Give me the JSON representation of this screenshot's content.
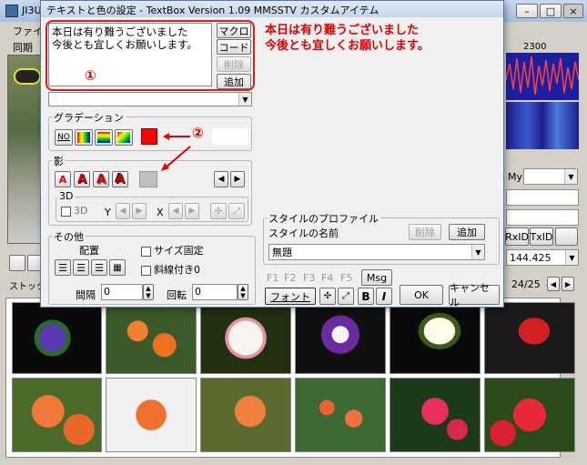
{
  "background_window": {
    "title": "JI3U",
    "menu_file": "ファイル",
    "sync_label": "同期",
    "freq_label": "2300",
    "my_label": "My",
    "rxid_label": "RxID",
    "txid_label": "TxID",
    "freq_value": "144.425",
    "stock_label": "ストック画",
    "page_counter": "24/25"
  },
  "dialog": {
    "title": "テキストと色の設定 - TextBox Version 1.09  MMSSTV カスタムアイテム",
    "text_content_line1": "本日は有り難うございました",
    "text_content_line2": "今後とも宜しくお願いします。",
    "macro_button": "マクロ",
    "code_button": "コード",
    "delete_button": "削除",
    "add_button": "追加",
    "gradation": {
      "label": "グラデーション",
      "no_button": "NO"
    },
    "shadow": {
      "label": "影",
      "a_glyph": "A",
      "sub_3d_label": "3D",
      "check_3d_label": "3D",
      "y_label": "Y",
      "x_label": "X"
    },
    "other": {
      "label": "その他",
      "layout_label": "配置",
      "fixed_size_label": "サイズ固定",
      "slanted_label": "斜線付き0",
      "spacing_label": "間隔",
      "spacing_value": "0",
      "rotation_label": "回転",
      "rotation_value": "0"
    },
    "style_profile": {
      "label": "スタイルのプロファイル",
      "delete_button": "削除",
      "add_button": "追加",
      "name_label": "スタイルの名前",
      "name_value": "無題"
    },
    "fkeys": [
      "F1",
      "F2",
      "F3",
      "F4",
      "F5"
    ],
    "msg_button": "Msg",
    "font_button": "フォント",
    "bold_button": "B",
    "italic_button": "I",
    "ok_button": "OK",
    "cancel_button": "キャンセル",
    "solid_color": "#ff0000"
  },
  "annotations": {
    "preview_line1": "本日は有り難うございました",
    "preview_line2": "今後とも宜しくお願いします。",
    "marker1": "①",
    "marker2": "②",
    "accent_color": "#e00000"
  },
  "window_controls": {
    "minimize": "–",
    "maximize": "□",
    "close": "×"
  }
}
